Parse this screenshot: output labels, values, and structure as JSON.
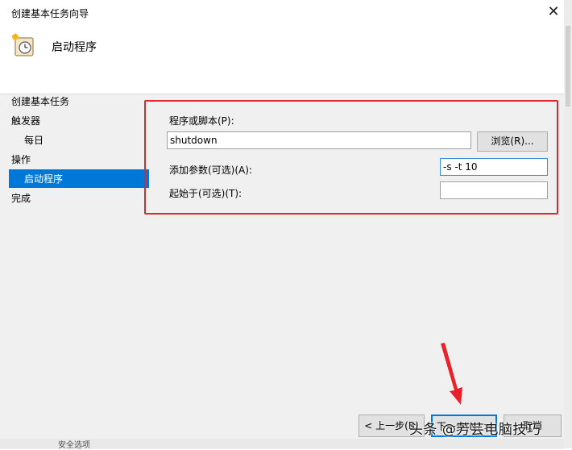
{
  "window": {
    "title": "创建基本任务向导"
  },
  "header": {
    "title": "启动程序",
    "icon": "task-clock-icon"
  },
  "nav": [
    {
      "label": "创建基本任务"
    },
    {
      "label": "触发器"
    },
    {
      "label": "每日"
    },
    {
      "label": "操作"
    },
    {
      "label": "启动程序",
      "selected": true
    },
    {
      "label": "完成"
    }
  ],
  "form": {
    "program_label": "程序或脚本(P):",
    "program_value": "shutdown",
    "browse_label": "浏览(R)...",
    "args_label": "添加参数(可选)(A):",
    "args_value": "-s -t 10",
    "start_label": "起始于(可选)(T):",
    "start_value": ""
  },
  "footer": {
    "back_label": "< 上一步(B)",
    "next_label": "下一步(N) >",
    "cancel_label": "取消",
    "watermark": "头条 @芳芸电脑技巧",
    "bottom_partial_text": "安全选项"
  },
  "colors": {
    "selection": "#0078d7",
    "highlight_box": "#e0262d",
    "arrow": "#e8212b"
  }
}
